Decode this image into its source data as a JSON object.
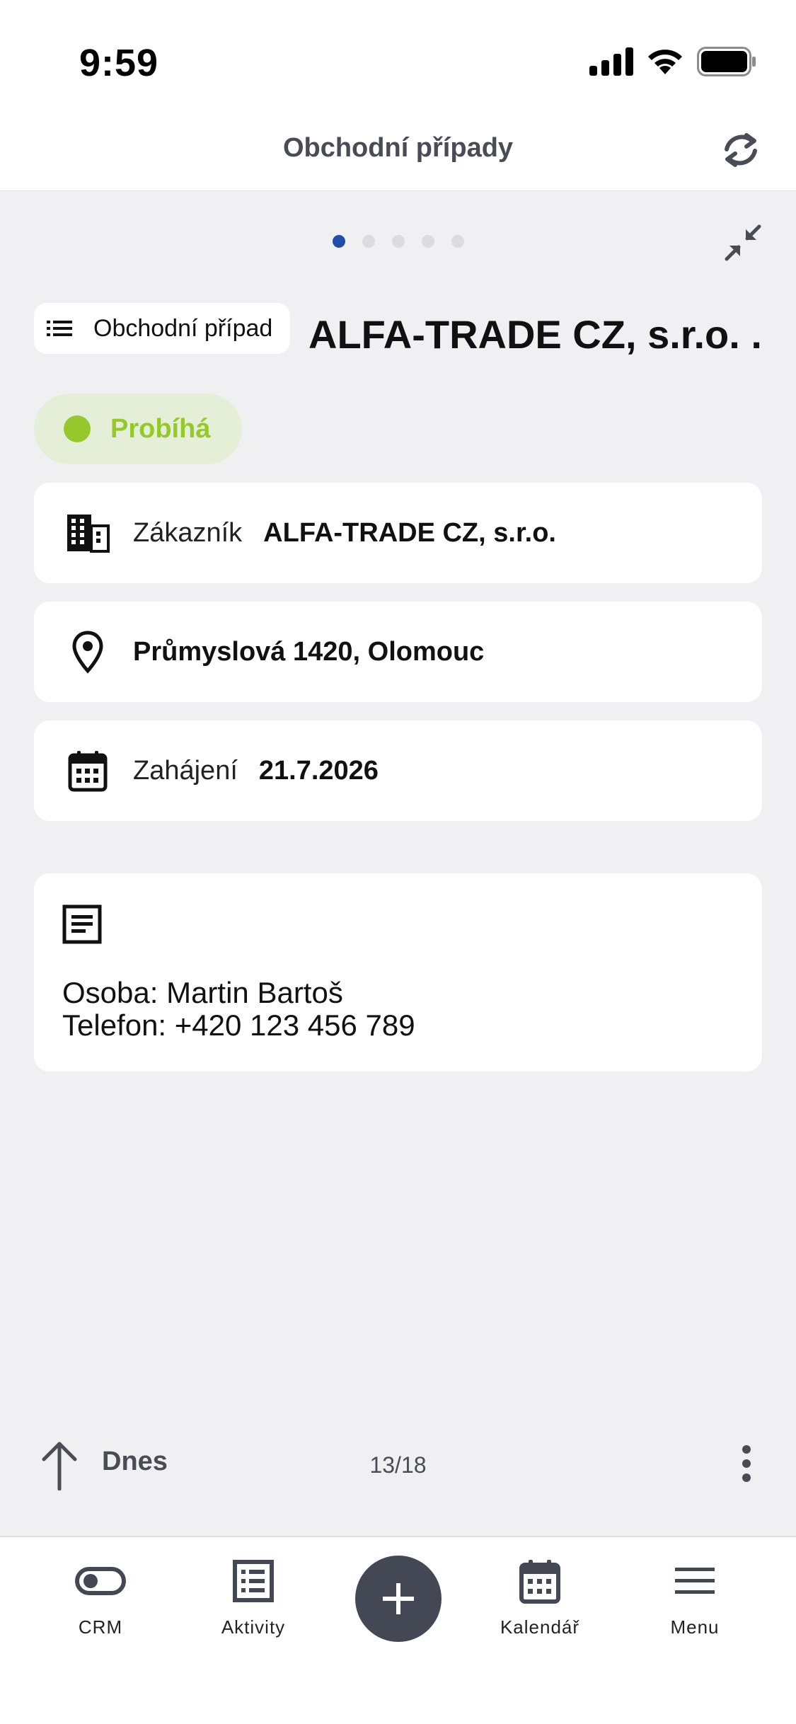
{
  "status_bar": {
    "time": "9:59"
  },
  "header": {
    "title": "Obchodní případy"
  },
  "pager": {
    "count": 5,
    "active_index": 0
  },
  "case": {
    "type_label": "Obchodní případ",
    "title": "ALFA-TRADE CZ, s.r.o. ...",
    "status": "Probíhá"
  },
  "details": {
    "customer_label": "Zákazník",
    "customer_value": "ALFA-TRADE CZ, s.r.o.",
    "address_value": "Průmyslová 1420, Olomouc",
    "start_label": "Zahájení",
    "start_value": "21.7.2026"
  },
  "note": {
    "line1": "Osoba: Martin Bartoš",
    "line2": "Telefon: +420 123 456 789"
  },
  "bottom_bar": {
    "today_label": "Dnes",
    "counter": "13/18"
  },
  "tabs": [
    {
      "label": "CRM",
      "icon": "toggle-icon"
    },
    {
      "label": "Aktivity",
      "icon": "list-icon"
    },
    {
      "label": "Kalendář",
      "icon": "calendar-icon"
    },
    {
      "label": "Menu",
      "icon": "menu-icon"
    }
  ],
  "colors": {
    "accent_blue": "#1f4fa7",
    "status_green": "#95c92b",
    "status_green_bg": "#e5efd8",
    "fab": "#434854",
    "background": "#f0f0f2"
  }
}
